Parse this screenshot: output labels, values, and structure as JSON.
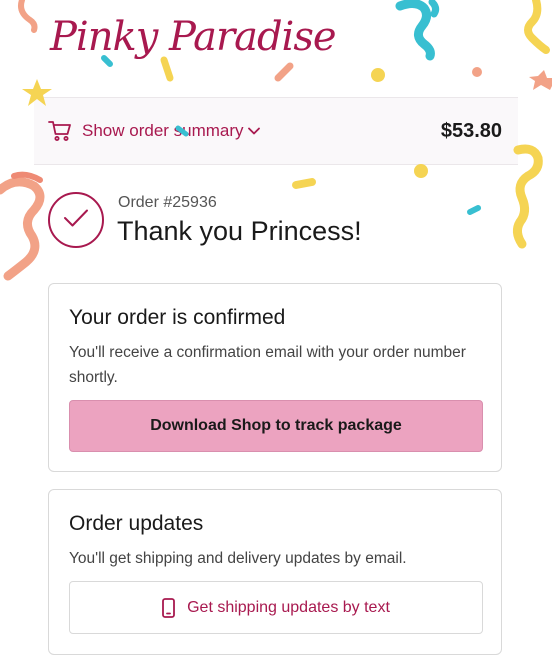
{
  "brand": {
    "name": "Pinky Paradise"
  },
  "order_summary": {
    "toggle_label": "Show order summary",
    "total": "$53.80"
  },
  "order": {
    "number": "Order #25936",
    "thank_you": "Thank you Princess!"
  },
  "confirmation_card": {
    "title": "Your order is confirmed",
    "text": "You'll receive a confirmation email with your order number shortly.",
    "button_label": "Download Shop to track package"
  },
  "updates_card": {
    "title": "Order updates",
    "text": "You'll get shipping and delivery updates by email.",
    "button_label": "Get shipping updates by text"
  },
  "icons": [
    "cart-icon",
    "chevron-down-icon",
    "check-icon",
    "phone-icon"
  ],
  "colors": {
    "accent": "#a8194f",
    "primary_button": "#eca3c0",
    "summary_bg": "#faf8fa"
  }
}
